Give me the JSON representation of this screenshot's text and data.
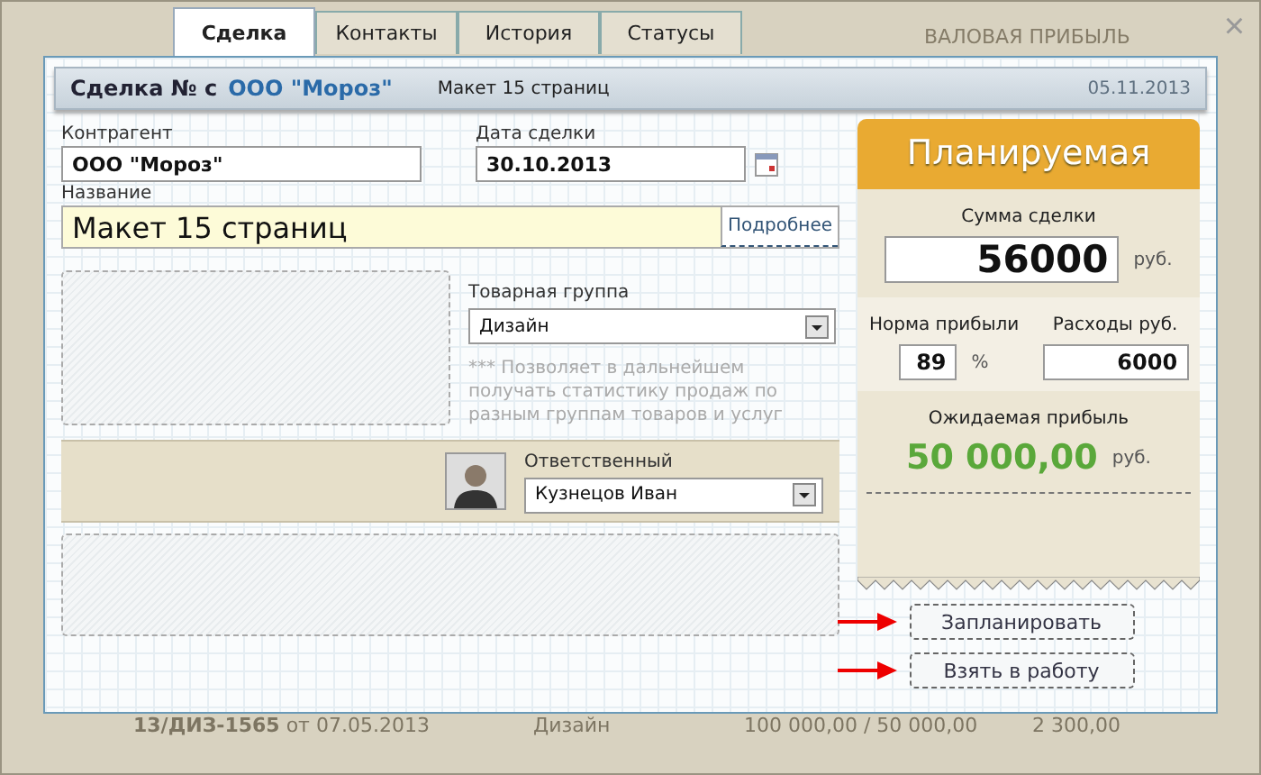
{
  "backdrop": {
    "header_label": "ВАЛОВАЯ ПРИБЫЛЬ",
    "row": {
      "number": "13/ДИЗ-1565",
      "from": "от",
      "date": "07.05.2013",
      "group": "Дизайн",
      "amounts": "100 000,00 / 50 000,00",
      "cost": "2 300,00"
    }
  },
  "close": "×",
  "tabs": [
    {
      "label": "Сделка",
      "selected": true
    },
    {
      "label": "Контакты",
      "selected": false
    },
    {
      "label": "История",
      "selected": false
    },
    {
      "label": "Статусы",
      "selected": false
    }
  ],
  "header": {
    "prefix": "Сделка № с",
    "client": "ООО \"Мороз\"",
    "subject": "Макет 15 страниц",
    "date": "05.11.2013"
  },
  "form": {
    "counterparty": {
      "label": "Контрагент",
      "value": "ООО \"Мороз\""
    },
    "deal_date": {
      "label": "Дата сделки",
      "value": "30.10.2013"
    },
    "name": {
      "label": "Название",
      "value": "Макет 15 страниц",
      "link": "Подробнее"
    },
    "product_group": {
      "label": "Товарная группа",
      "value": "Дизайн",
      "note": "*** Позволяет в дальнейшем получать статистику продаж по разным группам товаров и услуг"
    },
    "responsible": {
      "label": "Ответственный",
      "value": "Кузнецов Иван"
    }
  },
  "plan": {
    "title": "Планируемая",
    "amount": {
      "label": "Сумма сделки",
      "value": "56000",
      "unit": "руб."
    },
    "margin": {
      "label": "Норма прибыли",
      "value": "89",
      "unit": "%"
    },
    "expenses": {
      "label": "Расходы руб.",
      "value": "6000"
    },
    "expected": {
      "label": "Ожидаемая прибыль",
      "value": "50 000,00",
      "unit": "руб."
    }
  },
  "buttons": [
    {
      "label": "Запланировать"
    },
    {
      "label": "Взять в работу"
    }
  ]
}
